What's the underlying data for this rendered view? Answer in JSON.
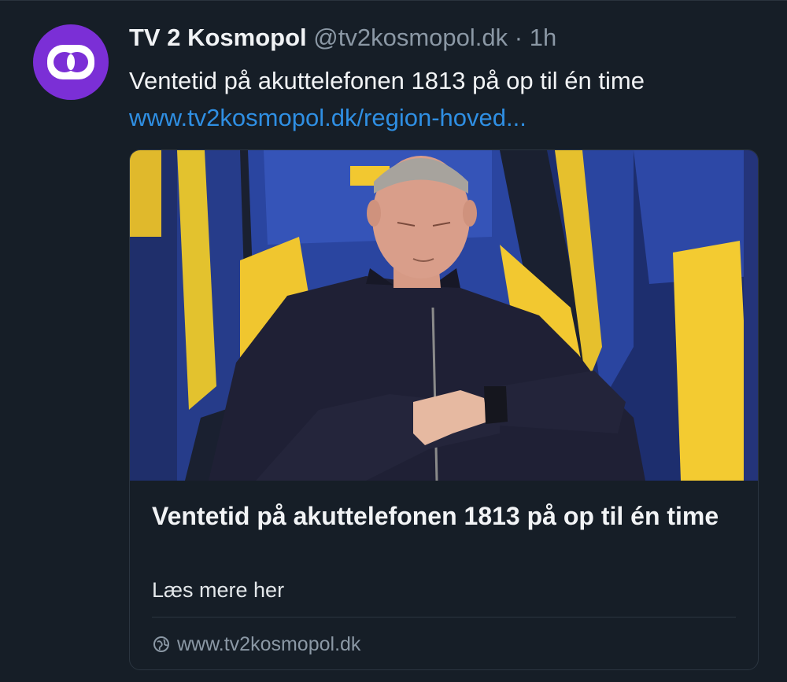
{
  "post": {
    "author": {
      "display_name": "TV 2 Kosmopol",
      "handle": "@tv2kosmopol.dk",
      "separator": "·",
      "time": "1h",
      "avatar_icon": "tv2-logo-icon",
      "avatar_color": "#7b2fd6"
    },
    "text": "Ventetid på akuttelefonen 1813 på op til én time",
    "link_text": "www.tv2kosmopol.dk/region-hoved...",
    "link_color": "#2f8fe3"
  },
  "card": {
    "image_icon": "man-checking-watch-photo",
    "title": "Ventetid på akuttelefonen 1813 på op til én time",
    "description": "Læs mere her",
    "domain_icon": "globe-icon",
    "domain": "www.tv2kosmopol.dk"
  }
}
